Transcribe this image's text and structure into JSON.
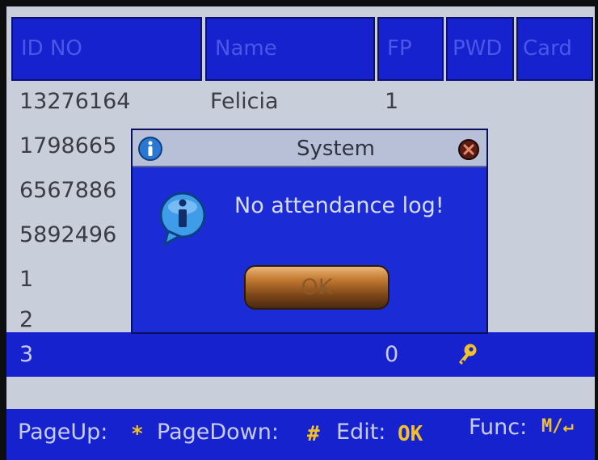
{
  "table": {
    "headers": {
      "id": "ID NO",
      "name": "Name",
      "fp": "FP",
      "pwd": "PWD",
      "card": "Card"
    },
    "rows": [
      {
        "id": "13276164",
        "name": "Felicia",
        "fp": "1"
      },
      {
        "id": "1798665",
        "name": "",
        "fp": ""
      },
      {
        "id": "6567886",
        "name": "",
        "fp": ""
      },
      {
        "id": "5892496",
        "name": "",
        "fp": ""
      },
      {
        "id": "1",
        "name": "",
        "fp": ""
      },
      {
        "id": "2",
        "name": "",
        "fp": ""
      },
      {
        "id": "3",
        "name": "",
        "fp": "0",
        "selected": true,
        "pwd_icon": "key-icon"
      }
    ]
  },
  "dialog": {
    "title": "System",
    "message": "No attendance log!",
    "ok_label": "OK",
    "icons": {
      "title": "info-icon",
      "body": "info-icon",
      "close": "close-icon"
    }
  },
  "footer": {
    "pageup_label": "PageUp:",
    "pageup_key": "*",
    "pagedown_label": "PageDown:",
    "pagedown_key": "#",
    "edit_label": "Edit:",
    "edit_key": "OK",
    "func_label": "Func:",
    "func_key": "M/↵"
  },
  "colors": {
    "accent_blue": "#1722cf",
    "key_yellow": "#f2c02a",
    "list_bg": "#c9cfda"
  }
}
